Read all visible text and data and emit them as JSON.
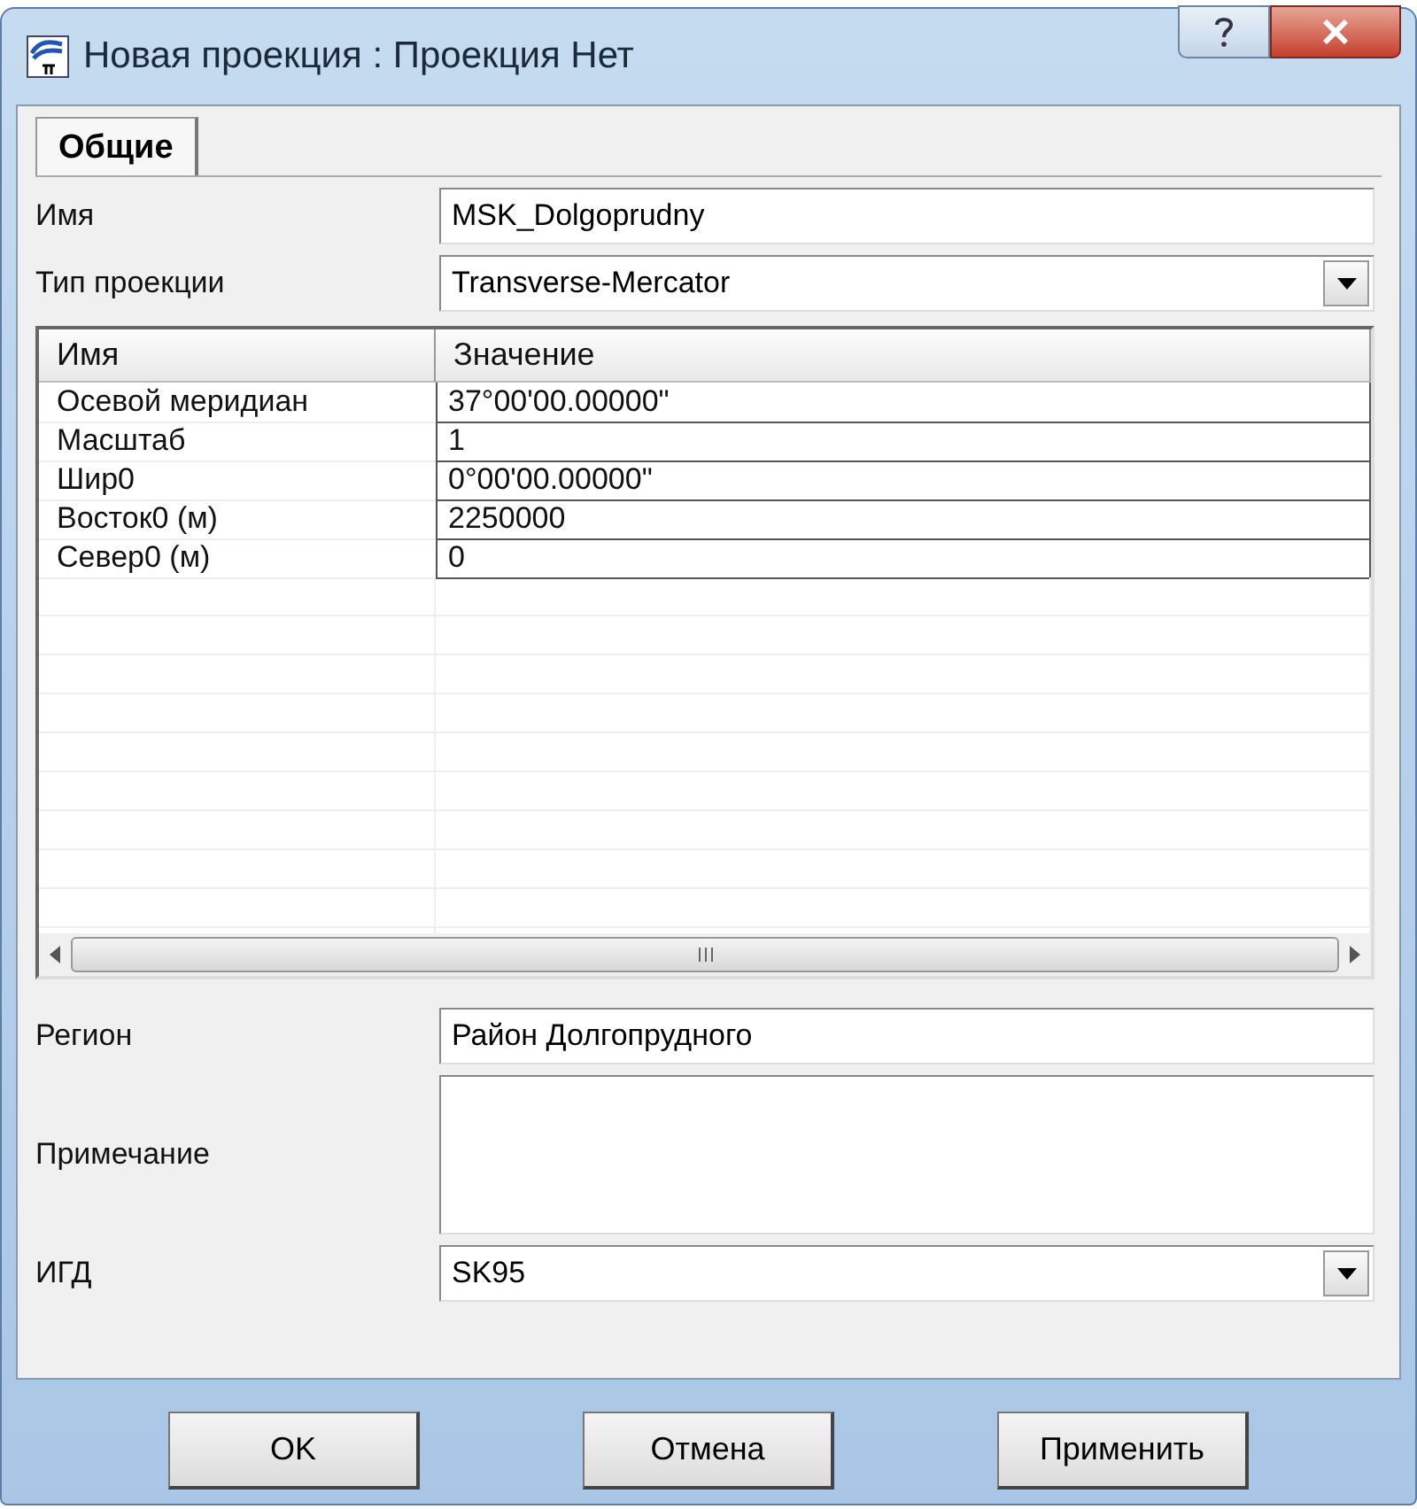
{
  "window": {
    "title": "Новая проекция : Проекция Нет"
  },
  "tabs": [
    {
      "label": "Общие",
      "selected": true
    }
  ],
  "name": {
    "label": "Имя",
    "value": "MSK_Dolgoprudny"
  },
  "projection_type": {
    "label": "Тип проекции",
    "value": "Transverse-Mercator"
  },
  "table": {
    "columns": [
      "Имя",
      "Значение"
    ],
    "rows": [
      {
        "name": "Осевой меридиан",
        "value": "37°00'00.00000\""
      },
      {
        "name": "Масштаб",
        "value": "1"
      },
      {
        "name": "Шир0",
        "value": "0°00'00.00000\""
      },
      {
        "name": "Восток0 (м)",
        "value": "2250000"
      },
      {
        "name": "Север0 (м)",
        "value": "0"
      }
    ]
  },
  "region": {
    "label": "Регион",
    "value": "Район Долгопрудного"
  },
  "note": {
    "label": "Примечание"
  },
  "igd": {
    "label": "ИГД",
    "value": "SK95"
  },
  "buttons": [
    "OK",
    "Отмена",
    "Применить"
  ]
}
